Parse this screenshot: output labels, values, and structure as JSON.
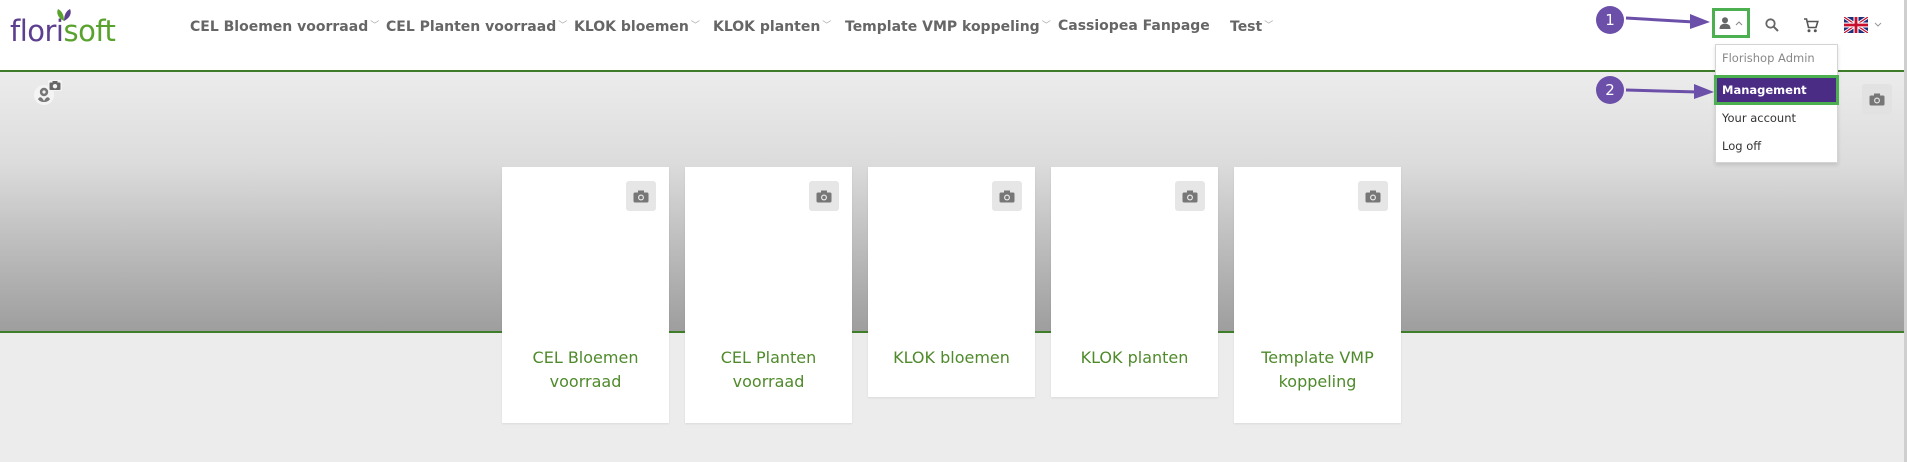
{
  "brand": {
    "part1": "flori",
    "part2": "soft"
  },
  "nav": [
    {
      "label": "CEL Bloemen voorraad",
      "caret": "﹀"
    },
    {
      "label": "CEL Planten voorraad",
      "caret": "﹀"
    },
    {
      "label": "KLOK bloemen",
      "caret": "﹀"
    },
    {
      "label": "KLOK planten",
      "caret": "﹀"
    },
    {
      "label": "Template VMP koppeling",
      "caret": "﹀"
    },
    {
      "label": "Cassiopea Fanpage",
      "caret": ""
    },
    {
      "label": "Test",
      "caret": "﹀"
    }
  ],
  "header_icons": [
    "user-icon",
    "search-icon",
    "cart-icon",
    "uk-flag-icon"
  ],
  "user_menu": {
    "header": "Florishop Admin",
    "items": [
      "Management",
      "Your account",
      "Log off"
    ]
  },
  "annotations": [
    "1",
    "2"
  ],
  "cards": [
    {
      "line1": "CEL Bloemen",
      "line2": "voorraad"
    },
    {
      "line1": "CEL Planten",
      "line2": "voorraad"
    },
    {
      "line1": "KLOK bloemen",
      "line2": ""
    },
    {
      "line1": "KLOK planten",
      "line2": ""
    },
    {
      "line1": "Template VMP",
      "line2": "koppeling"
    }
  ],
  "colors": {
    "brand_purple": "#5d3f8f",
    "brand_green": "#5aa22e",
    "highlight_green": "#4caf50",
    "menu_selected": "#4b2c85",
    "card_title": "#4f8a2b"
  }
}
